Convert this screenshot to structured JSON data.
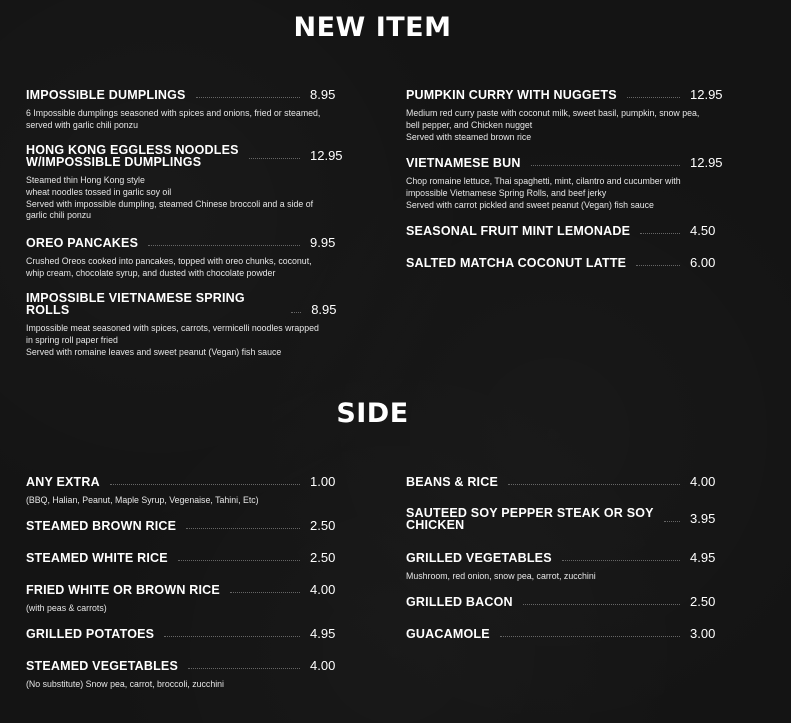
{
  "sections": {
    "new_item": {
      "title": "NEW ITEM",
      "left": [
        {
          "name": [
            "IMPOSSIBLE DUMPLINGS"
          ],
          "price": "8.95",
          "desc": [
            "6 Impossible dumplings seasoned with spices and onions, fried or steamed,",
            "served with garlic chili ponzu"
          ]
        },
        {
          "name": [
            "HONG KONG EGGLESS NOODLES",
            "W/IMPOSSIBLE DUMPLINGS"
          ],
          "price": "12.95",
          "desc": [
            "Steamed thin Hong Kong style",
            "wheat noodles tossed in garlic soy oil",
            "Served with impossible dumpling, steamed Chinese broccoli and a side of",
            "garlic chili ponzu"
          ]
        },
        {
          "name": [
            "OREO PANCAKES"
          ],
          "price": "9.95",
          "desc": [
            "Crushed Oreos cooked into pancakes, topped with oreo chunks, coconut,",
            "whip cream, chocolate syrup, and dusted with chocolate powder"
          ]
        },
        {
          "name": [
            "IMPOSSIBLE VIETNAMESE SPRING ROLLS"
          ],
          "price": "8.95",
          "desc": [
            "Impossible meat seasoned with spices, carrots, vermicelli noodles wrapped",
            "in spring roll paper fried",
            "Served with romaine leaves and sweet peanut (Vegan) fish sauce"
          ]
        }
      ],
      "right": [
        {
          "name": [
            "PUMPKIN CURRY WITH NUGGETS"
          ],
          "price": "12.95",
          "desc": [
            "Medium red curry paste with coconut milk, sweet basil, pumpkin, snow pea,",
            "bell pepper, and Chicken nugget",
            "Served with steamed brown rice"
          ]
        },
        {
          "name": [
            "VIETNAMESE BUN"
          ],
          "price": "12.95",
          "desc": [
            "Chop romaine lettuce, Thai spaghetti, mint, cilantro and cucumber with",
            "impossible Vietnamese Spring Rolls, and beef jerky",
            "Served with carrot pickled and sweet peanut (Vegan) fish sauce"
          ]
        },
        {
          "name": [
            "SEASONAL FRUIT MINT LEMONADE"
          ],
          "price": "4.50",
          "desc": []
        },
        {
          "name": [
            "SALTED MATCHA COCONUT LATTE"
          ],
          "price": "6.00",
          "desc": []
        }
      ]
    },
    "side": {
      "title": "SIDE",
      "left": [
        {
          "name": [
            "ANY EXTRA"
          ],
          "price": "1.00",
          "desc": [
            "(BBQ, Halian, Peanut, Maple Syrup, Vegenaise, Tahini, Etc)"
          ]
        },
        {
          "name": [
            "STEAMED BROWN RICE"
          ],
          "price": "2.50",
          "desc": []
        },
        {
          "name": [
            "STEAMED WHITE RICE"
          ],
          "price": "2.50",
          "desc": []
        },
        {
          "name": [
            "FRIED WHITE OR BROWN RICE"
          ],
          "price": "4.00",
          "desc": [
            "(with peas & carrots)"
          ]
        },
        {
          "name": [
            "GRILLED POTATOES"
          ],
          "price": "4.95",
          "desc": []
        },
        {
          "name": [
            "STEAMED VEGETABLES"
          ],
          "price": "4.00",
          "desc": [
            "(No substitute) Snow pea, carrot, broccoli, zucchini"
          ]
        }
      ],
      "right": [
        {
          "name": [
            "BEANS & RICE"
          ],
          "price": "4.00",
          "desc": []
        },
        {
          "name": [
            "SAUTEED SOY PEPPER STEAK OR SOY",
            "CHICKEN"
          ],
          "price": "3.95",
          "desc": []
        },
        {
          "name": [
            "GRILLED VEGETABLES"
          ],
          "price": "4.95",
          "desc": [
            "Mushroom, red onion, snow pea, carrot, zucchini"
          ]
        },
        {
          "name": [
            "GRILLED BACON"
          ],
          "price": "2.50",
          "desc": []
        },
        {
          "name": [
            "GUACAMOLE"
          ],
          "price": "3.00",
          "desc": []
        }
      ]
    }
  }
}
